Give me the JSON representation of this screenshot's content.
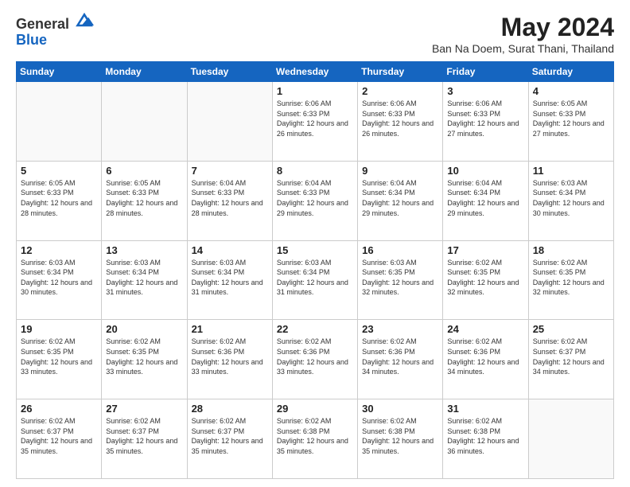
{
  "header": {
    "logo_line1": "General",
    "logo_line2": "Blue",
    "month_year": "May 2024",
    "location": "Ban Na Doem, Surat Thani, Thailand"
  },
  "days_of_week": [
    "Sunday",
    "Monday",
    "Tuesday",
    "Wednesday",
    "Thursday",
    "Friday",
    "Saturday"
  ],
  "weeks": [
    [
      {
        "day": "",
        "info": ""
      },
      {
        "day": "",
        "info": ""
      },
      {
        "day": "",
        "info": ""
      },
      {
        "day": "1",
        "info": "Sunrise: 6:06 AM\nSunset: 6:33 PM\nDaylight: 12 hours\nand 26 minutes."
      },
      {
        "day": "2",
        "info": "Sunrise: 6:06 AM\nSunset: 6:33 PM\nDaylight: 12 hours\nand 26 minutes."
      },
      {
        "day": "3",
        "info": "Sunrise: 6:06 AM\nSunset: 6:33 PM\nDaylight: 12 hours\nand 27 minutes."
      },
      {
        "day": "4",
        "info": "Sunrise: 6:05 AM\nSunset: 6:33 PM\nDaylight: 12 hours\nand 27 minutes."
      }
    ],
    [
      {
        "day": "5",
        "info": "Sunrise: 6:05 AM\nSunset: 6:33 PM\nDaylight: 12 hours\nand 28 minutes."
      },
      {
        "day": "6",
        "info": "Sunrise: 6:05 AM\nSunset: 6:33 PM\nDaylight: 12 hours\nand 28 minutes."
      },
      {
        "day": "7",
        "info": "Sunrise: 6:04 AM\nSunset: 6:33 PM\nDaylight: 12 hours\nand 28 minutes."
      },
      {
        "day": "8",
        "info": "Sunrise: 6:04 AM\nSunset: 6:33 PM\nDaylight: 12 hours\nand 29 minutes."
      },
      {
        "day": "9",
        "info": "Sunrise: 6:04 AM\nSunset: 6:34 PM\nDaylight: 12 hours\nand 29 minutes."
      },
      {
        "day": "10",
        "info": "Sunrise: 6:04 AM\nSunset: 6:34 PM\nDaylight: 12 hours\nand 29 minutes."
      },
      {
        "day": "11",
        "info": "Sunrise: 6:03 AM\nSunset: 6:34 PM\nDaylight: 12 hours\nand 30 minutes."
      }
    ],
    [
      {
        "day": "12",
        "info": "Sunrise: 6:03 AM\nSunset: 6:34 PM\nDaylight: 12 hours\nand 30 minutes."
      },
      {
        "day": "13",
        "info": "Sunrise: 6:03 AM\nSunset: 6:34 PM\nDaylight: 12 hours\nand 31 minutes."
      },
      {
        "day": "14",
        "info": "Sunrise: 6:03 AM\nSunset: 6:34 PM\nDaylight: 12 hours\nand 31 minutes."
      },
      {
        "day": "15",
        "info": "Sunrise: 6:03 AM\nSunset: 6:34 PM\nDaylight: 12 hours\nand 31 minutes."
      },
      {
        "day": "16",
        "info": "Sunrise: 6:03 AM\nSunset: 6:35 PM\nDaylight: 12 hours\nand 32 minutes."
      },
      {
        "day": "17",
        "info": "Sunrise: 6:02 AM\nSunset: 6:35 PM\nDaylight: 12 hours\nand 32 minutes."
      },
      {
        "day": "18",
        "info": "Sunrise: 6:02 AM\nSunset: 6:35 PM\nDaylight: 12 hours\nand 32 minutes."
      }
    ],
    [
      {
        "day": "19",
        "info": "Sunrise: 6:02 AM\nSunset: 6:35 PM\nDaylight: 12 hours\nand 33 minutes."
      },
      {
        "day": "20",
        "info": "Sunrise: 6:02 AM\nSunset: 6:35 PM\nDaylight: 12 hours\nand 33 minutes."
      },
      {
        "day": "21",
        "info": "Sunrise: 6:02 AM\nSunset: 6:36 PM\nDaylight: 12 hours\nand 33 minutes."
      },
      {
        "day": "22",
        "info": "Sunrise: 6:02 AM\nSunset: 6:36 PM\nDaylight: 12 hours\nand 33 minutes."
      },
      {
        "day": "23",
        "info": "Sunrise: 6:02 AM\nSunset: 6:36 PM\nDaylight: 12 hours\nand 34 minutes."
      },
      {
        "day": "24",
        "info": "Sunrise: 6:02 AM\nSunset: 6:36 PM\nDaylight: 12 hours\nand 34 minutes."
      },
      {
        "day": "25",
        "info": "Sunrise: 6:02 AM\nSunset: 6:37 PM\nDaylight: 12 hours\nand 34 minutes."
      }
    ],
    [
      {
        "day": "26",
        "info": "Sunrise: 6:02 AM\nSunset: 6:37 PM\nDaylight: 12 hours\nand 35 minutes."
      },
      {
        "day": "27",
        "info": "Sunrise: 6:02 AM\nSunset: 6:37 PM\nDaylight: 12 hours\nand 35 minutes."
      },
      {
        "day": "28",
        "info": "Sunrise: 6:02 AM\nSunset: 6:37 PM\nDaylight: 12 hours\nand 35 minutes."
      },
      {
        "day": "29",
        "info": "Sunrise: 6:02 AM\nSunset: 6:38 PM\nDaylight: 12 hours\nand 35 minutes."
      },
      {
        "day": "30",
        "info": "Sunrise: 6:02 AM\nSunset: 6:38 PM\nDaylight: 12 hours\nand 35 minutes."
      },
      {
        "day": "31",
        "info": "Sunrise: 6:02 AM\nSunset: 6:38 PM\nDaylight: 12 hours\nand 36 minutes."
      },
      {
        "day": "",
        "info": ""
      }
    ]
  ]
}
